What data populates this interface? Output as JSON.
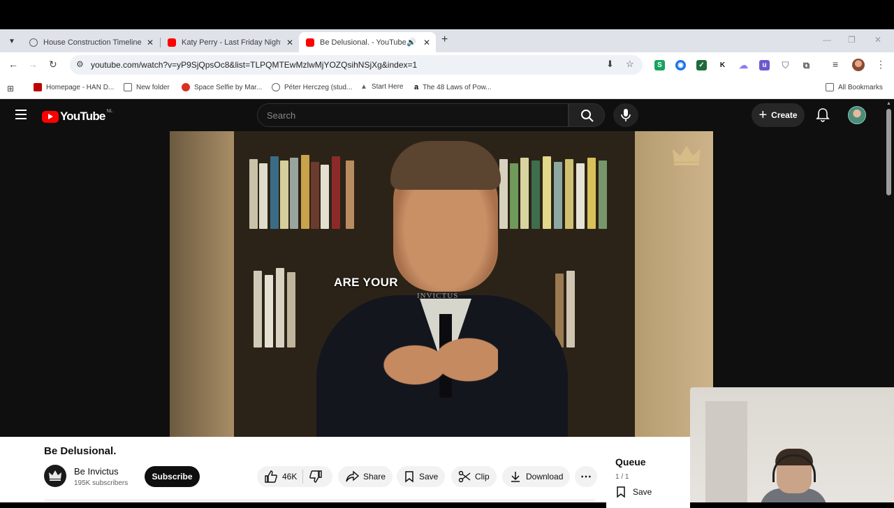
{
  "tabs": [
    {
      "title": "House Construction Timeline",
      "favicon_color": "#5f6368"
    },
    {
      "title": "Katy Perry - Last Friday Night (T",
      "favicon_color": "#ff0000"
    },
    {
      "title": "Be Delusional. - YouTube",
      "favicon_color": "#ff0000"
    }
  ],
  "address_bar": {
    "url": "youtube.com/watch?v=yP9SjQpsOc8&list=TLPQMTEwMzlwMjYOZQsihNSjXg&index=1"
  },
  "extensions": [
    {
      "name": "s-extension-icon",
      "glyph": "S",
      "color": "#1aa260"
    },
    {
      "name": "circle-extension-icon",
      "glyph": "◉",
      "color": "#1a73e8"
    },
    {
      "name": "check-extension-icon",
      "glyph": "✓",
      "color": "#1e6b3a"
    },
    {
      "name": "k-extension-icon",
      "glyph": "K",
      "color": "#ffffff"
    },
    {
      "name": "cloud-extension-icon",
      "glyph": "☁",
      "color": "#8e7cf0"
    },
    {
      "name": "u-extension-icon",
      "glyph": "u",
      "color": "#6a5acd"
    },
    {
      "name": "shield-extension-icon",
      "glyph": "⛉",
      "color": "#9aa0a6"
    }
  ],
  "bookmarks": [
    {
      "label": "Homepage - HAN D...",
      "icon_color": "#c00000"
    },
    {
      "label": "New folder",
      "icon_color": "#5f6368"
    },
    {
      "label": "Space Selfie by Mar...",
      "icon_color": "#d93025"
    },
    {
      "label": "Péter Herczeg (stud...",
      "icon_color": "#5f6368"
    },
    {
      "label": "Start Here",
      "icon_color": "#5f6368"
    },
    {
      "label": "The 48 Laws of Pow...",
      "icon_color": "#000000"
    },
    {
      "label": "All Bookmarks",
      "icon_color": "#5f6368"
    }
  ],
  "youtube": {
    "logo_text": "YouTube",
    "country": "NL",
    "search_placeholder": "Search",
    "create_label": "Create",
    "video_caption": "ARE YOUR",
    "watermark": "INVICTUS",
    "title": "Be Delusional.",
    "channel_name": "Be Invictus",
    "subscribers": "195K subscribers",
    "subscribe_label": "Subscribe",
    "likes": "46K",
    "share_label": "Share",
    "save_label": "Save",
    "clip_label": "Clip",
    "download_label": "Download",
    "queue": {
      "title": "Queue",
      "count": "1 / 1",
      "save_label": "Save"
    }
  }
}
